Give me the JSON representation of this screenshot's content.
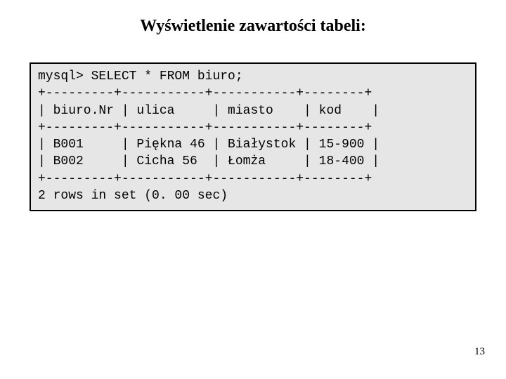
{
  "title": "Wyświetlenie zawartości tabeli:",
  "code": {
    "l1": "mysql> SELECT * FROM biuro;",
    "l2": "+---------+-----------+-----------+--------+",
    "l3": "| biuro.Nr | ulica     | miasto    | kod    |",
    "l4": "+---------+-----------+-----------+--------+",
    "l5": "| B001     | Piękna 46 | Białystok | 15-900 |",
    "l6": "| B002     | Cicha 56  | Łomża     | 18-400 |",
    "l7": "+---------+-----------+-----------+--------+",
    "l8": "2 rows in set (0. 00 sec)"
  },
  "page_number": "13",
  "chart_data": {
    "type": "table",
    "title": "biuro",
    "columns": [
      "biuro.Nr",
      "ulica",
      "miasto",
      "kod"
    ],
    "rows": [
      [
        "B001",
        "Piękna 46",
        "Białystok",
        "15-900"
      ],
      [
        "B002",
        "Cicha 56",
        "Łomża",
        "18-400"
      ]
    ],
    "footer": "2 rows in set (0. 00 sec)",
    "query": "SELECT * FROM biuro;"
  }
}
